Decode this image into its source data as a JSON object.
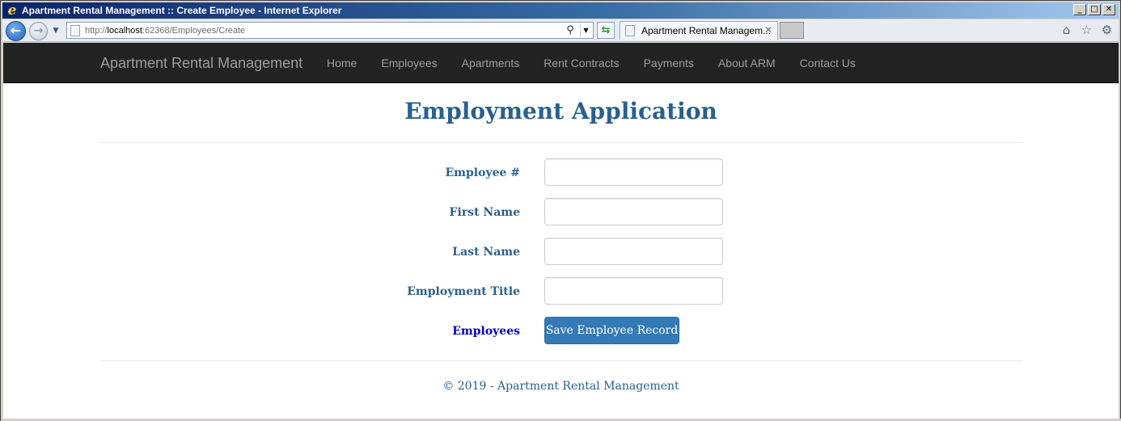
{
  "window": {
    "title": "Apartment Rental Management :: Create Employee - Internet Explorer",
    "controls": {
      "minimize": "_",
      "maximize": "□",
      "close": "✕"
    }
  },
  "browser": {
    "address_prefix": "http://",
    "address_host": "localhost",
    "address_rest": ":62368/Employees/Create",
    "tab_label": "Apartment Rental Managem...",
    "icons": [
      "back-icon",
      "forward-icon",
      "search-icon",
      "refresh-icon",
      "home-icon",
      "favorites-icon",
      "tools-gear-icon"
    ]
  },
  "navbar": {
    "brand": "Apartment Rental Management",
    "items": [
      {
        "label": "Home"
      },
      {
        "label": "Employees"
      },
      {
        "label": "Apartments"
      },
      {
        "label": "Rent Contracts"
      },
      {
        "label": "Payments"
      },
      {
        "label": "About ARM"
      },
      {
        "label": "Contact Us"
      }
    ]
  },
  "form": {
    "heading": "Employment Application",
    "fields": [
      {
        "label": "Employee #",
        "value": ""
      },
      {
        "label": "First Name",
        "value": ""
      },
      {
        "label": "Last Name",
        "value": ""
      },
      {
        "label": "Employment Title",
        "value": ""
      }
    ],
    "back_link": "Employees",
    "submit_label": "Save Employee Record"
  },
  "footer": {
    "text": "© 2019 - Apartment Rental Management"
  },
  "colors": {
    "navbar_bg": "#222222",
    "nav_text": "#9d9d9d",
    "heading": "#286090",
    "link": "#0000cc",
    "button": "#337ab7"
  }
}
